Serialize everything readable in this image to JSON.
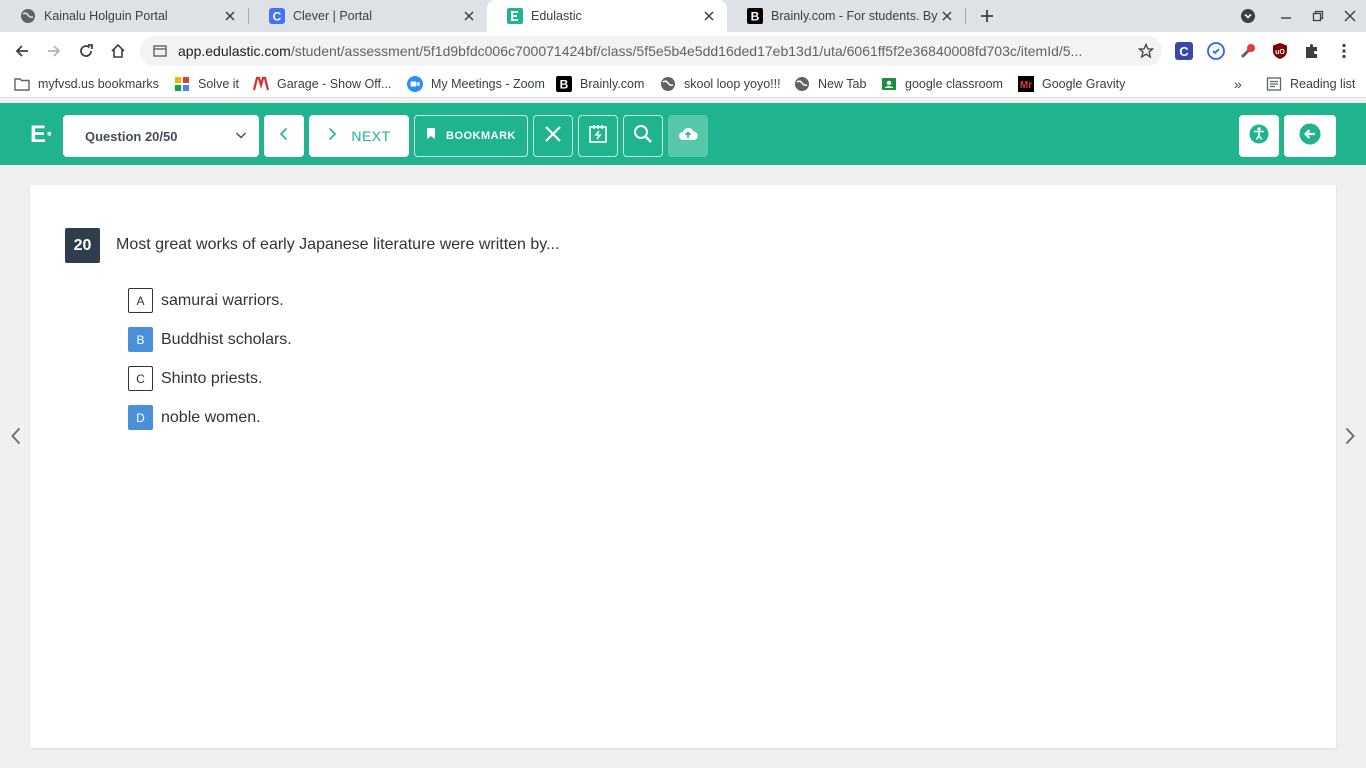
{
  "browser": {
    "tabs": [
      {
        "title": "Kainalu Holguin Portal"
      },
      {
        "title": "Clever | Portal"
      },
      {
        "title": "Edulastic"
      },
      {
        "title": "Brainly.com - For students. By st"
      }
    ],
    "url_host": "app.edulastic.com",
    "url_path": "/student/assessment/5f1d9bfdc006c700071424bf/class/5f5e5b4e5dd16ded17eb13d1/uta/6061ff5f2e36840008fd703c/itemId/5...",
    "bookmarks": [
      {
        "label": "myfvsd.us bookmarks"
      },
      {
        "label": "Solve it"
      },
      {
        "label": "Garage - Show Off..."
      },
      {
        "label": "My Meetings - Zoom"
      },
      {
        "label": "Brainly.com"
      },
      {
        "label": "skool loop yoyo!!!"
      },
      {
        "label": "New Tab"
      },
      {
        "label": "google classroom"
      },
      {
        "label": "Google Gravity"
      }
    ],
    "overflow_label": "»",
    "reading_list": "Reading list"
  },
  "app": {
    "logo": "E·",
    "question_select": "Question 20/50",
    "next_label": "NEXT",
    "bookmark_label": "BOOKMARK",
    "accent": "#1fb48d"
  },
  "question": {
    "number": "20",
    "text": "Most great works of early Japanese literature were written by...",
    "options": [
      {
        "letter": "A",
        "text": "samurai warriors."
      },
      {
        "letter": "B",
        "text": "Buddhist scholars."
      },
      {
        "letter": "C",
        "text": "Shinto priests."
      },
      {
        "letter": "D",
        "text": "noble women."
      }
    ]
  }
}
